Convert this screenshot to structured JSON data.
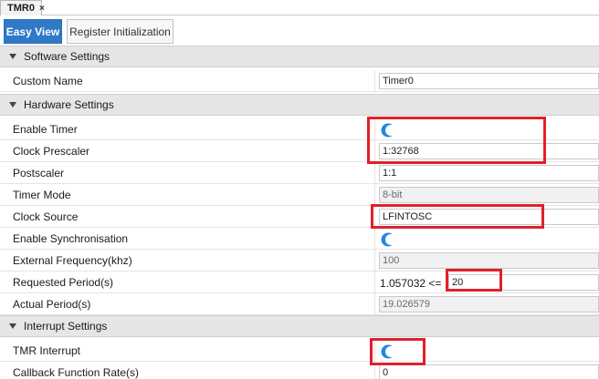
{
  "doc_tab": {
    "title": "TMR0",
    "close": "×"
  },
  "subtabs": [
    {
      "label": "Easy View"
    },
    {
      "label": "Register Initialization"
    }
  ],
  "sections": {
    "software": "Software Settings",
    "hardware": "Hardware Settings",
    "interrupt": "Interrupt Settings"
  },
  "rows": {
    "custom_name": {
      "label": "Custom Name",
      "value": "Timer0"
    },
    "enable_timer": {
      "label": "Enable Timer",
      "checked": true
    },
    "clock_prescaler": {
      "label": "Clock Prescaler",
      "value": "1:32768"
    },
    "postscaler": {
      "label": "Postscaler",
      "value": "1:1"
    },
    "timer_mode": {
      "label": "Timer Mode",
      "value": "8-bit"
    },
    "clock_source": {
      "label": "Clock Source",
      "value": "LFINTOSC"
    },
    "enable_sync": {
      "label": "Enable Synchronisation",
      "checked": true
    },
    "ext_freq": {
      "label": "External Frequency(khz)",
      "value": "100"
    },
    "requested_period": {
      "label": "Requested Period(s)",
      "prefix": "1.057032 <=",
      "value": "20"
    },
    "actual_period": {
      "label": "Actual Period(s)",
      "value": "19.026579"
    },
    "tmr_interrupt": {
      "label": "TMR Interrupt",
      "checked": true
    },
    "callback_rate": {
      "label": "Callback Function Rate(s)",
      "value": "0"
    }
  },
  "colors": {
    "accent": "#2f79c7",
    "toggle": "#1e88e5",
    "highlight": "#e0202a"
  },
  "icons": {
    "toggle": "toggle-switch-icon",
    "collapse": "collapse-triangle-icon"
  }
}
